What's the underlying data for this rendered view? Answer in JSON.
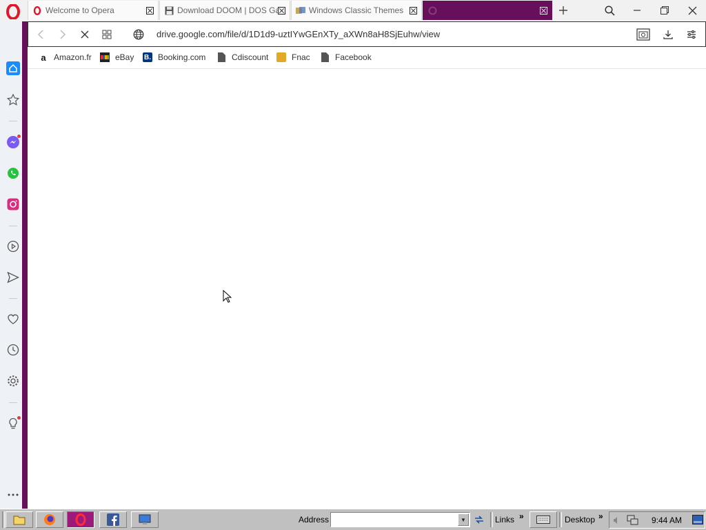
{
  "tabs": [
    {
      "title": "Welcome to Opera",
      "favicon": "opera-icon"
    },
    {
      "title": "Download DOOM | DOS Games Archive",
      "favicon": "floppy-icon"
    },
    {
      "title": "Windows Classic Themes",
      "favicon": "theme-icon"
    },
    {
      "title": "",
      "favicon": "loading-icon",
      "active": true
    }
  ],
  "address_bar": {
    "url": "drive.google.com/file/d/1D1d9-uztIYwGEnXTy_aXWn8aH8SjEuhw/view"
  },
  "bookmarks": [
    {
      "label": "Amazon.fr",
      "icon": "amazon-icon"
    },
    {
      "label": "eBay",
      "icon": "ebay-icon"
    },
    {
      "label": "Booking.com",
      "icon": "booking-icon"
    },
    {
      "label": "Cdiscount",
      "icon": "page-icon"
    },
    {
      "label": "Fnac",
      "icon": "fnac-icon"
    },
    {
      "label": "Facebook",
      "icon": "page-icon"
    }
  ],
  "sidebar": {
    "items": [
      "home-icon",
      "speed-dial-icon",
      "messenger-icon",
      "whatsapp-icon",
      "instagram-icon",
      "player-icon",
      "send-icon",
      "heart-icon",
      "history-icon",
      "settings-icon",
      "lightbulb-icon",
      "more-icon"
    ]
  },
  "taskbar": {
    "address_label": "Address",
    "links_label": "Links",
    "desktop_label": "Desktop",
    "time": "9:44 AM",
    "chevron": "»"
  },
  "colors": {
    "opera_purple": "#66105c",
    "opera_red": "#e0162b",
    "taskbar": "#c0c0c0",
    "sidebar_bg": "#eef1f6"
  }
}
